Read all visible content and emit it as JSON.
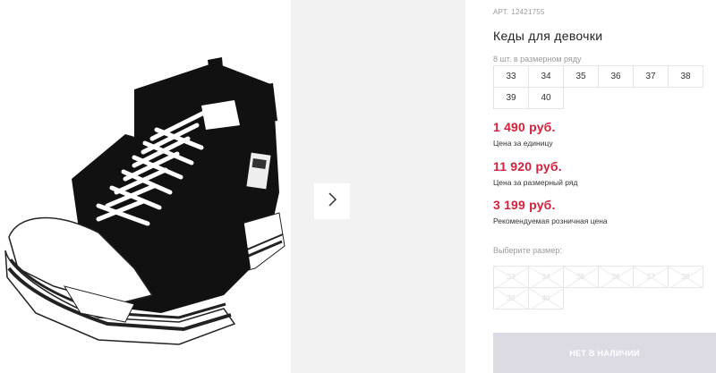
{
  "product": {
    "article_label": "АРТ.",
    "article_value": "12421755",
    "title": "Кеды для девочки",
    "in_row_text": "8 шт. в размерном ряду",
    "sizes": [
      "33",
      "34",
      "35",
      "36",
      "37",
      "38",
      "39",
      "40"
    ]
  },
  "prices": {
    "unit_price": "1 490 руб.",
    "unit_label": "Цена за единицу",
    "row_price": "11 920 руб.",
    "row_label": "Цена за размерный ряд",
    "retail_price": "3 199 руб.",
    "retail_label": "Рекомендуемая розничная цена"
  },
  "size_picker": {
    "label": "Выберите размер:",
    "options": [
      "33",
      "34",
      "35",
      "36",
      "37",
      "38",
      "39",
      "40"
    ]
  },
  "buy_button": {
    "label": "НЕТ В НАЛИЧИИ"
  },
  "gallery": {
    "next_icon": "chevron-right-icon"
  },
  "colors": {
    "price": "#d3213c",
    "button_disabled": "#dcdbe4",
    "gallery_bg": "#f2f2f2"
  }
}
